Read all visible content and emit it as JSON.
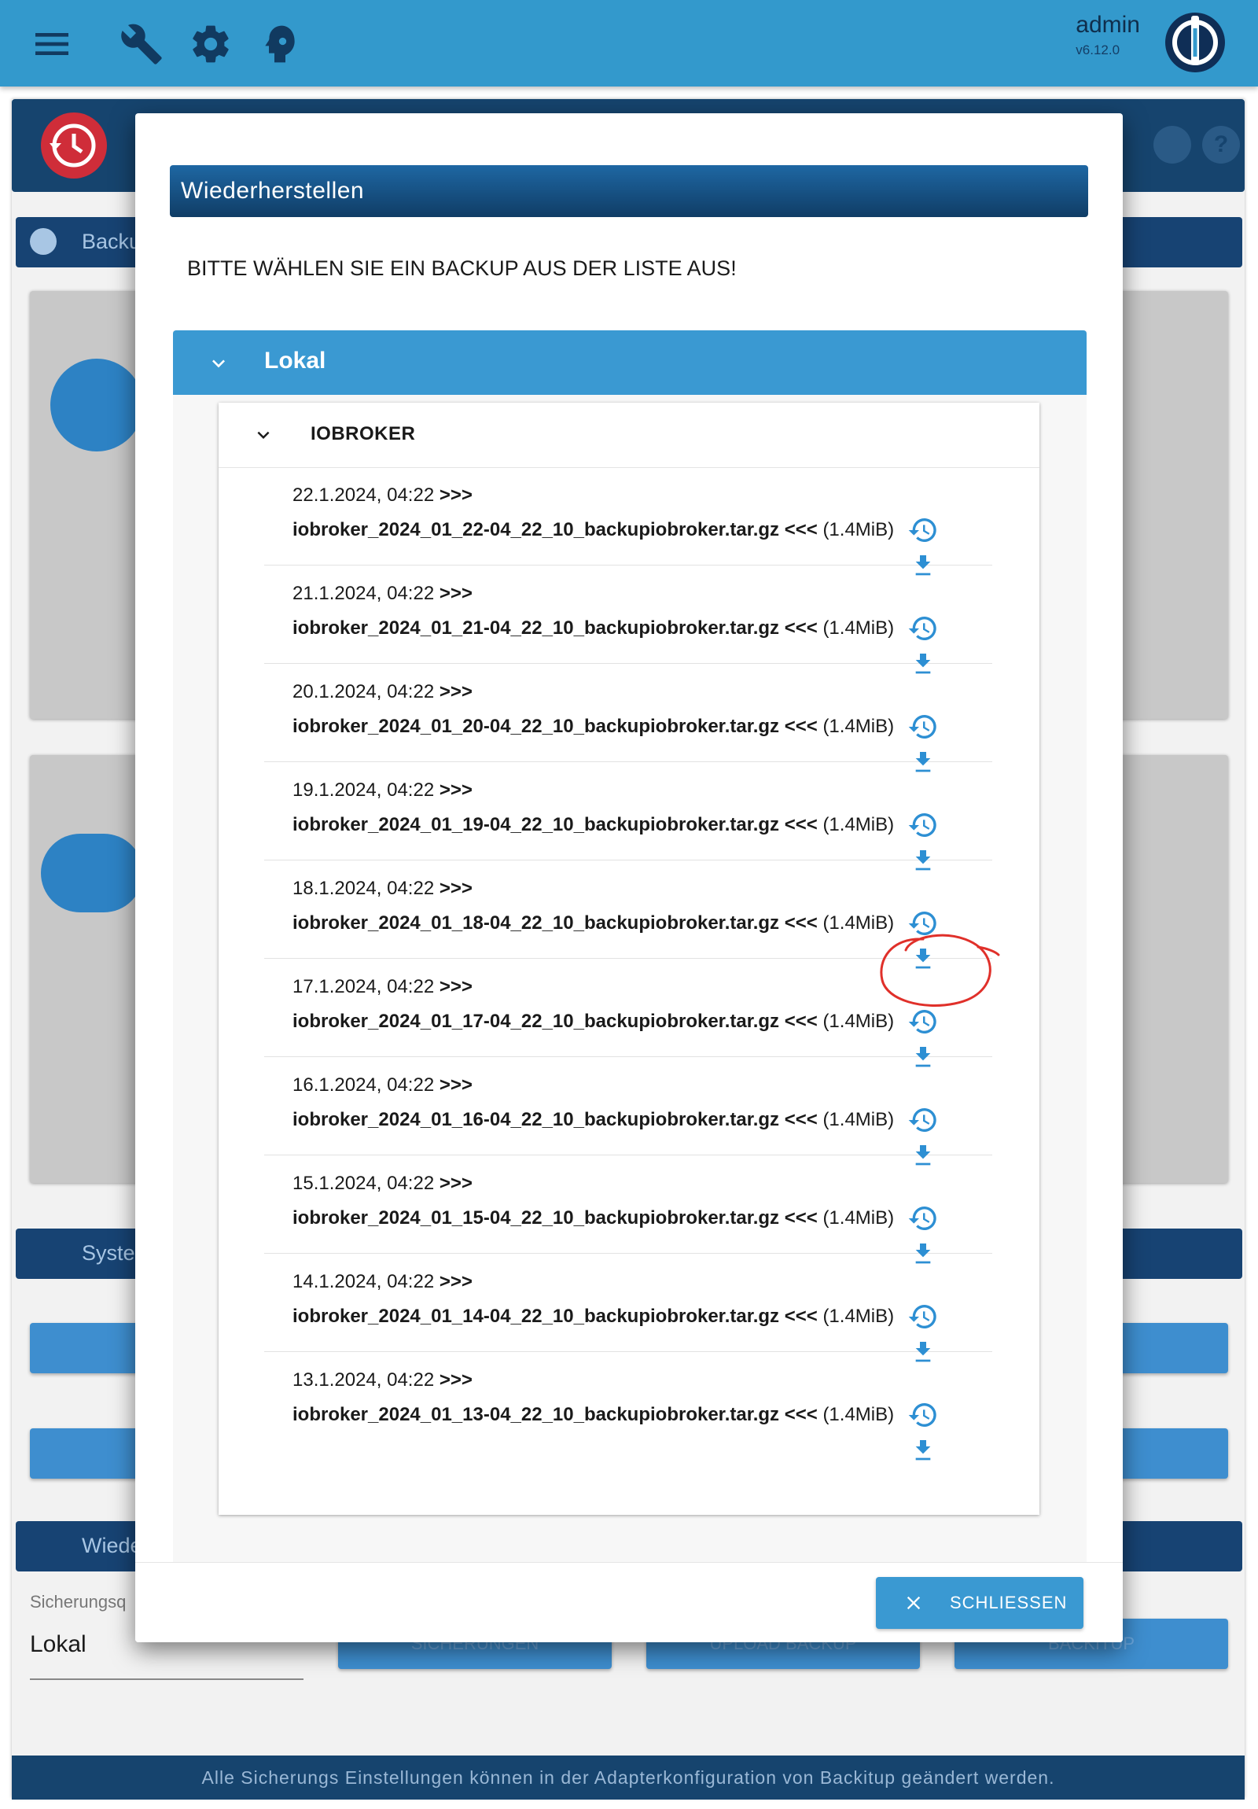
{
  "appbar": {
    "user_name": "admin",
    "version": "v6.12.0",
    "color": "#3399cc",
    "icons": [
      "menu-icon",
      "wrench-icon",
      "gear-icon",
      "head-icon",
      "iobroker-logo"
    ]
  },
  "background": {
    "info_section_partial": "Backu",
    "system_section_partial": "Syste",
    "restore_section_partial": "Wiede",
    "source_label_partial": "Sicherungsq",
    "source_value": "Lokal",
    "button_backups": "SICHERUNGEN",
    "button_upload": "UPLOAD BACKUP",
    "button_backitup": "BACKITUP",
    "footer_text": "Alle Sicherungs Einstellungen können in der Adapterkonfiguration von Backitup geändert werden."
  },
  "modal": {
    "title": "Wiederherstellen",
    "instruction": "BITTE WÄHLEN SIE EIN BACKUP AUS DER LISTE AUS!",
    "location_label": "Lokal",
    "group_label": "IOBROKER",
    "close_label": "SCHLIESSEN",
    "accent_color": "#3a99d2",
    "backups": [
      {
        "date": "22.1.2024, 04:22",
        "prefix": ">>>",
        "file": "iobroker_2024_01_22-04_22_10_backupiobroker.tar.gz",
        "suffix": "<<<",
        "size": "(1.4MiB)"
      },
      {
        "date": "21.1.2024, 04:22",
        "prefix": ">>>",
        "file": "iobroker_2024_01_21-04_22_10_backupiobroker.tar.gz",
        "suffix": "<<<",
        "size": "(1.4MiB)"
      },
      {
        "date": "20.1.2024, 04:22",
        "prefix": ">>>",
        "file": "iobroker_2024_01_20-04_22_10_backupiobroker.tar.gz",
        "suffix": "<<<",
        "size": "(1.4MiB)"
      },
      {
        "date": "19.1.2024, 04:22",
        "prefix": ">>>",
        "file": "iobroker_2024_01_19-04_22_10_backupiobroker.tar.gz",
        "suffix": "<<<",
        "size": "(1.4MiB)"
      },
      {
        "date": "18.1.2024, 04:22",
        "prefix": ">>>",
        "file": "iobroker_2024_01_18-04_22_10_backupiobroker.tar.gz",
        "suffix": "<<<",
        "size": "(1.4MiB)"
      },
      {
        "date": "17.1.2024, 04:22",
        "prefix": ">>>",
        "file": "iobroker_2024_01_17-04_22_10_backupiobroker.tar.gz",
        "suffix": "<<<",
        "size": "(1.4MiB)"
      },
      {
        "date": "16.1.2024, 04:22",
        "prefix": ">>>",
        "file": "iobroker_2024_01_16-04_22_10_backupiobroker.tar.gz",
        "suffix": "<<<",
        "size": "(1.4MiB)"
      },
      {
        "date": "15.1.2024, 04:22",
        "prefix": ">>>",
        "file": "iobroker_2024_01_15-04_22_10_backupiobroker.tar.gz",
        "suffix": "<<<",
        "size": "(1.4MiB)"
      },
      {
        "date": "14.1.2024, 04:22",
        "prefix": ">>>",
        "file": "iobroker_2024_01_14-04_22_10_backupiobroker.tar.gz",
        "suffix": "<<<",
        "size": "(1.4MiB)"
      },
      {
        "date": "13.1.2024, 04:22",
        "prefix": ">>>",
        "file": "iobroker_2024_01_13-04_22_10_backupiobroker.tar.gz",
        "suffix": "<<<",
        "size": "(1.4MiB)"
      }
    ]
  },
  "annotation": {
    "color": "#e0302a",
    "shape": "hand-drawn-circle"
  }
}
